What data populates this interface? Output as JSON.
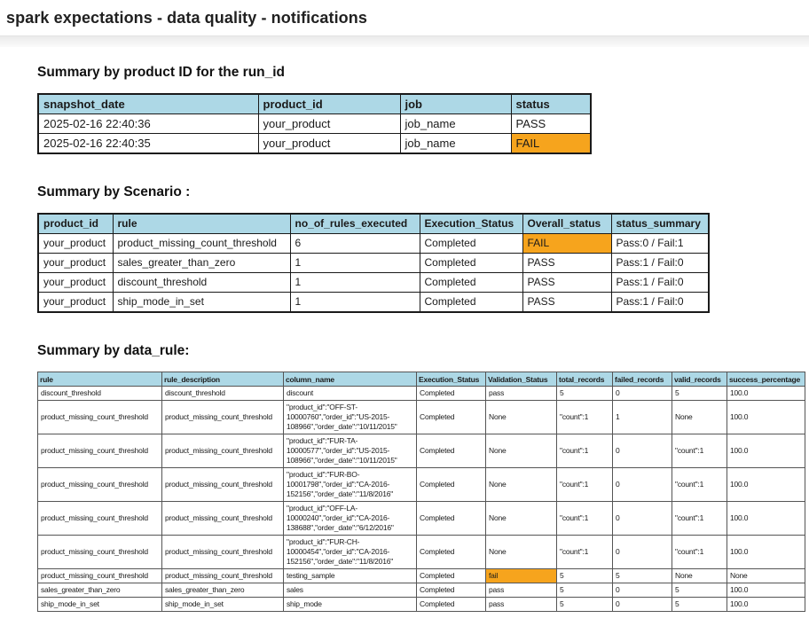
{
  "title": "spark expectations - data quality - notifications",
  "colors": {
    "header_bg": "#add8e6",
    "fail_bg": "#f6a41d",
    "border_dark": "#1a1a1a"
  },
  "run_summary": {
    "heading": "Summary by product ID for the run_id",
    "columns": [
      "snapshot_date",
      "product_id",
      "job",
      "status"
    ],
    "rows": [
      [
        "2025-02-16 22:40:36",
        "your_product",
        "job_name",
        "PASS"
      ],
      [
        "2025-02-16 22:40:35",
        "your_product",
        "job_name",
        "FAIL"
      ]
    ]
  },
  "scenario_summary": {
    "heading": "Summary by Scenario :",
    "columns": [
      "product_id",
      "rule",
      "no_of_rules_executed",
      "Execution_Status",
      "Overall_status",
      "status_summary"
    ],
    "rows": [
      [
        "your_product",
        "product_missing_count_threshold",
        "6",
        "Completed",
        "FAIL",
        "Pass:0 / Fail:1"
      ],
      [
        "your_product",
        "sales_greater_than_zero",
        "1",
        "Completed",
        "PASS",
        "Pass:1 / Fail:0"
      ],
      [
        "your_product",
        "discount_threshold",
        "1",
        "Completed",
        "PASS",
        "Pass:1 / Fail:0"
      ],
      [
        "your_product",
        "ship_mode_in_set",
        "1",
        "Completed",
        "PASS",
        "Pass:1 / Fail:0"
      ]
    ]
  },
  "data_rule_summary": {
    "heading": "Summary by data_rule:",
    "columns": [
      "rule",
      "rule_description",
      "column_name",
      "Execution_Status",
      "Validation_Status",
      "total_records",
      "failed_records",
      "valid_records",
      "success_percentage"
    ],
    "rows": [
      [
        "discount_threshold",
        "discount_threshold",
        "discount",
        "Completed",
        "pass",
        "5",
        "0",
        "5",
        "100.0"
      ],
      [
        "product_missing_count_threshold",
        "product_missing_count_threshold",
        "\"product_id\":\"OFF-ST-10000760\",\"order_id\":\"US-2015-108966\",\"order_date\":\"10/11/2015\"",
        "Completed",
        "None",
        "\"count\":1",
        "1",
        "None",
        "100.0"
      ],
      [
        "product_missing_count_threshold",
        "product_missing_count_threshold",
        "\"product_id\":\"FUR-TA-10000577\",\"order_id\":\"US-2015-108966\",\"order_date\":\"10/11/2015\"",
        "Completed",
        "None",
        "\"count\":1",
        "0",
        "\"count\":1",
        "100.0"
      ],
      [
        "product_missing_count_threshold",
        "product_missing_count_threshold",
        "\"product_id\":\"FUR-BO-10001798\",\"order_id\":\"CA-2016-152156\",\"order_date\":\"11/8/2016\"",
        "Completed",
        "None",
        "\"count\":1",
        "0",
        "\"count\":1",
        "100.0"
      ],
      [
        "product_missing_count_threshold",
        "product_missing_count_threshold",
        "\"product_id\":\"OFF-LA-10000240\",\"order_id\":\"CA-2016-138688\",\"order_date\":\"6/12/2016\"",
        "Completed",
        "None",
        "\"count\":1",
        "0",
        "\"count\":1",
        "100.0"
      ],
      [
        "product_missing_count_threshold",
        "product_missing_count_threshold",
        "\"product_id\":\"FUR-CH-10000454\",\"order_id\":\"CA-2016-152156\",\"order_date\":\"11/8/2016\"",
        "Completed",
        "None",
        "\"count\":1",
        "0",
        "\"count\":1",
        "100.0"
      ],
      [
        "product_missing_count_threshold",
        "product_missing_count_threshold",
        "testing_sample",
        "Completed",
        "fail",
        "5",
        "5",
        "None",
        "None"
      ],
      [
        "sales_greater_than_zero",
        "sales_greater_than_zero",
        "sales",
        "Completed",
        "pass",
        "5",
        "0",
        "5",
        "100.0"
      ],
      [
        "ship_mode_in_set",
        "ship_mode_in_set",
        "ship_mode",
        "Completed",
        "pass",
        "5",
        "0",
        "5",
        "100.0"
      ]
    ]
  }
}
